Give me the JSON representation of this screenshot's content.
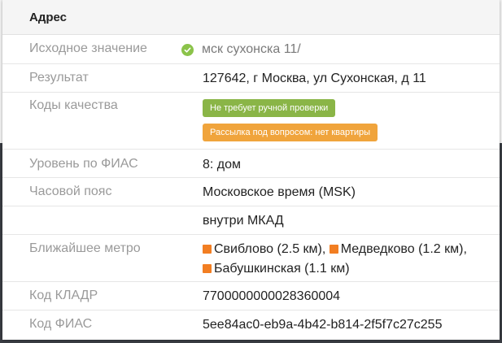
{
  "panel": {
    "title": "Адрес"
  },
  "rows": {
    "source": {
      "label": "Исходное значение",
      "value": "мск сухонска 11/",
      "icon": "check-circle-icon",
      "icon_color": "#8bc34a"
    },
    "result": {
      "label": "Результат",
      "value": "127642, г Москва, ул Сухонская, д 11"
    },
    "quality": {
      "label": "Коды качества",
      "badges": [
        {
          "text": "Не требует ручной проверки",
          "color": "#8ab547"
        },
        {
          "text": "Рассылка под вопросом: нет квартиры",
          "color": "#f0a43c"
        }
      ]
    },
    "fias_level": {
      "label": "Уровень по ФИАС",
      "value": "8: дом"
    },
    "timezone": {
      "label": "Часовой пояс",
      "value": "Московское время (MSK)"
    },
    "mkad": {
      "label": "",
      "value": "внутри МКАД"
    },
    "metro": {
      "label": "Ближайшее метро",
      "icon": "metro-line-icon",
      "icon_color": "#f27e22",
      "stations": [
        {
          "name": "Свиблово (2.5 км)",
          "separator": ", "
        },
        {
          "name": "Медведково (1.2 км)",
          "separator": ", "
        },
        {
          "name": "Бабушкинская (1.1 км)",
          "separator": ""
        }
      ]
    },
    "kladr": {
      "label": "Код КЛАДР",
      "value": "7700000000028360004"
    },
    "fias_code": {
      "label": "Код ФИАС",
      "value": "5ee84ac0-eb9a-4b42-b814-2f5f7c27c255"
    }
  }
}
